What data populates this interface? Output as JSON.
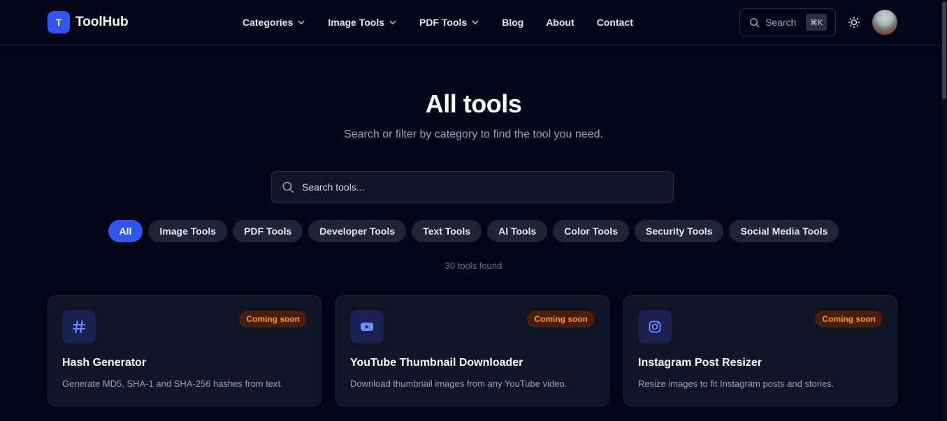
{
  "header": {
    "logo_letter": "T",
    "brand": "ToolHub",
    "nav": [
      {
        "label": "Categories",
        "dropdown": true
      },
      {
        "label": "Image Tools",
        "dropdown": true
      },
      {
        "label": "PDF Tools",
        "dropdown": true
      },
      {
        "label": "Blog",
        "dropdown": false
      },
      {
        "label": "About",
        "dropdown": false
      },
      {
        "label": "Contact",
        "dropdown": false
      }
    ],
    "search_label": "Search",
    "search_shortcut": "⌘K",
    "theme_icon": "sun-icon"
  },
  "hero": {
    "title": "All tools",
    "subtitle": "Search or filter by category to find the tool you need.",
    "search_placeholder": "Search tools..."
  },
  "filters": {
    "active": "All",
    "items": [
      "All",
      "Image Tools",
      "PDF Tools",
      "Developer Tools",
      "Text Tools",
      "AI Tools",
      "Color Tools",
      "Security Tools",
      "Social Media Tools"
    ]
  },
  "results": {
    "count_text": "30 tools found"
  },
  "cards": [
    {
      "name": "Hash Generator",
      "description": "Generate MD5, SHA-1 and SHA-256 hashes from text.",
      "badge": "Coming soon",
      "icon": "hash-icon"
    },
    {
      "name": "YouTube Thumbnail Downloader",
      "description": "Download thumbnail images from any YouTube video.",
      "badge": "Coming soon",
      "icon": "youtube-icon"
    },
    {
      "name": "Instagram Post Resizer",
      "description": "Resize images to fit Instagram posts and stories.",
      "badge": "Coming soon",
      "icon": "instagram-icon"
    }
  ],
  "colors": {
    "background": "#030617",
    "accent": "#2f56f0",
    "card": "#0f1526",
    "badge_text": "#f59e0b",
    "badge_bg": "#4a1d0c"
  }
}
